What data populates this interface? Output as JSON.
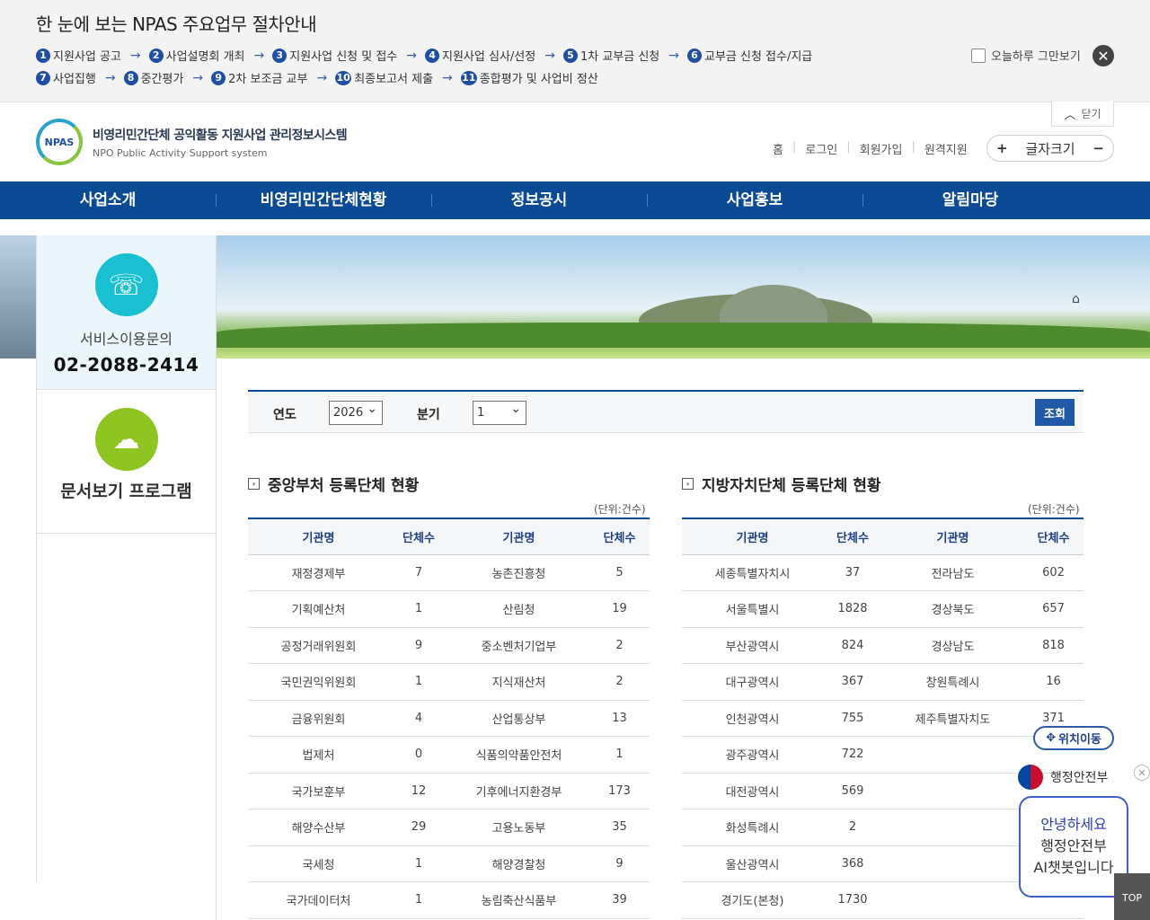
{
  "guide": {
    "title": "한 눈에 보는 NPAS 주요업무 절차안내",
    "row1": [
      {
        "n": "1",
        "label": "지원사업 공고"
      },
      {
        "n": "2",
        "label": "사업설명회 개최"
      },
      {
        "n": "3",
        "label": "지원사업 신청 및 접수"
      },
      {
        "n": "4",
        "label": "지원사업 심사/선정"
      },
      {
        "n": "5",
        "label": "1차 교부금 신청"
      },
      {
        "n": "6",
        "label": "교부금 신청 접수/지급"
      }
    ],
    "row2": [
      {
        "n": "7",
        "label": "사업집행"
      },
      {
        "n": "8",
        "label": "중간평가"
      },
      {
        "n": "9",
        "label": "2차 보조금 교부"
      },
      {
        "n": "10",
        "label": "최종보고서 제출"
      },
      {
        "n": "11",
        "label": "종합평가 및 사업비 정산"
      }
    ],
    "today_label": "오늘하루 그만보기",
    "close_tab": "닫기"
  },
  "header": {
    "logo_mark": "NPAS",
    "logo_ko": "비영리민간단체 공익활동 지원사업 관리정보시스템",
    "logo_en": "NPO Public Activity Support system",
    "util": [
      "홈",
      "로그인",
      "회원가입",
      "원격지원"
    ],
    "fontsize_label": "글자크기",
    "plus": "+",
    "minus": "−"
  },
  "nav": [
    "사업소개",
    "비영리민간단체현황",
    "정보공시",
    "사업홍보",
    "알림마당"
  ],
  "side": {
    "service_label": "서비스이용문의",
    "service_phone": "02-2088-2414",
    "doc_label": "문서보기 프로그램"
  },
  "search": {
    "year_label": "연도",
    "year_value": "2026",
    "quarter_label": "분기",
    "quarter_value": "1",
    "button": "조회"
  },
  "central": {
    "title": "중앙부처 등록단체 현황",
    "unit": "(단위:건수)",
    "headers": [
      "기관명",
      "단체수",
      "기관명",
      "단체수"
    ],
    "rows": [
      [
        "재정경제부",
        "7",
        "농촌진흥청",
        "5"
      ],
      [
        "기획예산처",
        "1",
        "산림청",
        "19"
      ],
      [
        "공정거래위원회",
        "9",
        "중소벤처기업부",
        "2"
      ],
      [
        "국민권익위원회",
        "1",
        "지식재산처",
        "2"
      ],
      [
        "금융위원회",
        "4",
        "산업통상부",
        "13"
      ],
      [
        "법제처",
        "0",
        "식품의약품안전처",
        "1"
      ],
      [
        "국가보훈부",
        "12",
        "기후에너지환경부",
        "173"
      ],
      [
        "해양수산부",
        "29",
        "고용노동부",
        "35"
      ],
      [
        "국세청",
        "1",
        "해양경찰청",
        "9"
      ],
      [
        "국가데이터처",
        "1",
        "농림축산식품부",
        "39"
      ]
    ]
  },
  "local": {
    "title": "지방자치단체 등록단체 현황",
    "unit": "(단위:건수)",
    "headers": [
      "기관명",
      "단체수",
      "기관명",
      "단체수"
    ],
    "rows": [
      [
        "세종특별자치시",
        "37",
        "전라남도",
        "602"
      ],
      [
        "서울특별시",
        "1828",
        "경상북도",
        "657"
      ],
      [
        "부산광역시",
        "824",
        "경상남도",
        "818"
      ],
      [
        "대구광역시",
        "367",
        "창원특례시",
        "16"
      ],
      [
        "인천광역시",
        "755",
        "제주특별자치도",
        "371"
      ],
      [
        "광주광역시",
        "722",
        "",
        ""
      ],
      [
        "대전광역시",
        "569",
        "",
        ""
      ],
      [
        "화성특례시",
        "2",
        "",
        ""
      ],
      [
        "울산광역시",
        "368",
        "",
        ""
      ],
      [
        "경기도(본청)",
        "1730",
        "",
        ""
      ]
    ]
  },
  "float": {
    "location_btn": "위치이동",
    "ministry": "행정안전부",
    "chat_l1": "안녕하세요",
    "chat_l2": "행정안전부",
    "chat_l3": "AI챗봇입니다",
    "top": "TOP"
  },
  "colors": {
    "nav": "#0b4a94",
    "accent": "#1f59a7",
    "service": "#18c0d2",
    "doc": "#8ec521"
  }
}
